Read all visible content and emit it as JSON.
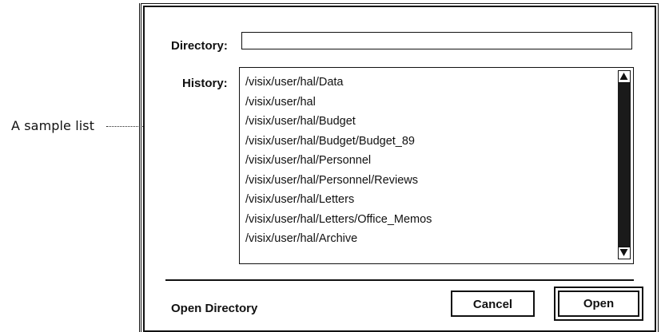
{
  "callout": {
    "text": "A sample list"
  },
  "dialog": {
    "directory_label": "Directory:",
    "directory_value": "",
    "history_label": "History:",
    "history_items": [
      "/visix/user/hal/Data",
      "/visix/user/hal",
      "/visix/user/hal/Budget",
      "/visix/user/hal/Budget/Budget_89",
      "/visix/user/hal/Personnel",
      "/visix/user/hal/Personnel/Reviews",
      "/visix/user/hal/Letters",
      "/visix/user/hal/Letters/Office_Memos",
      "/visix/user/hal/Archive"
    ],
    "status_text": "Open Directory",
    "cancel_label": "Cancel",
    "open_label": "Open"
  }
}
